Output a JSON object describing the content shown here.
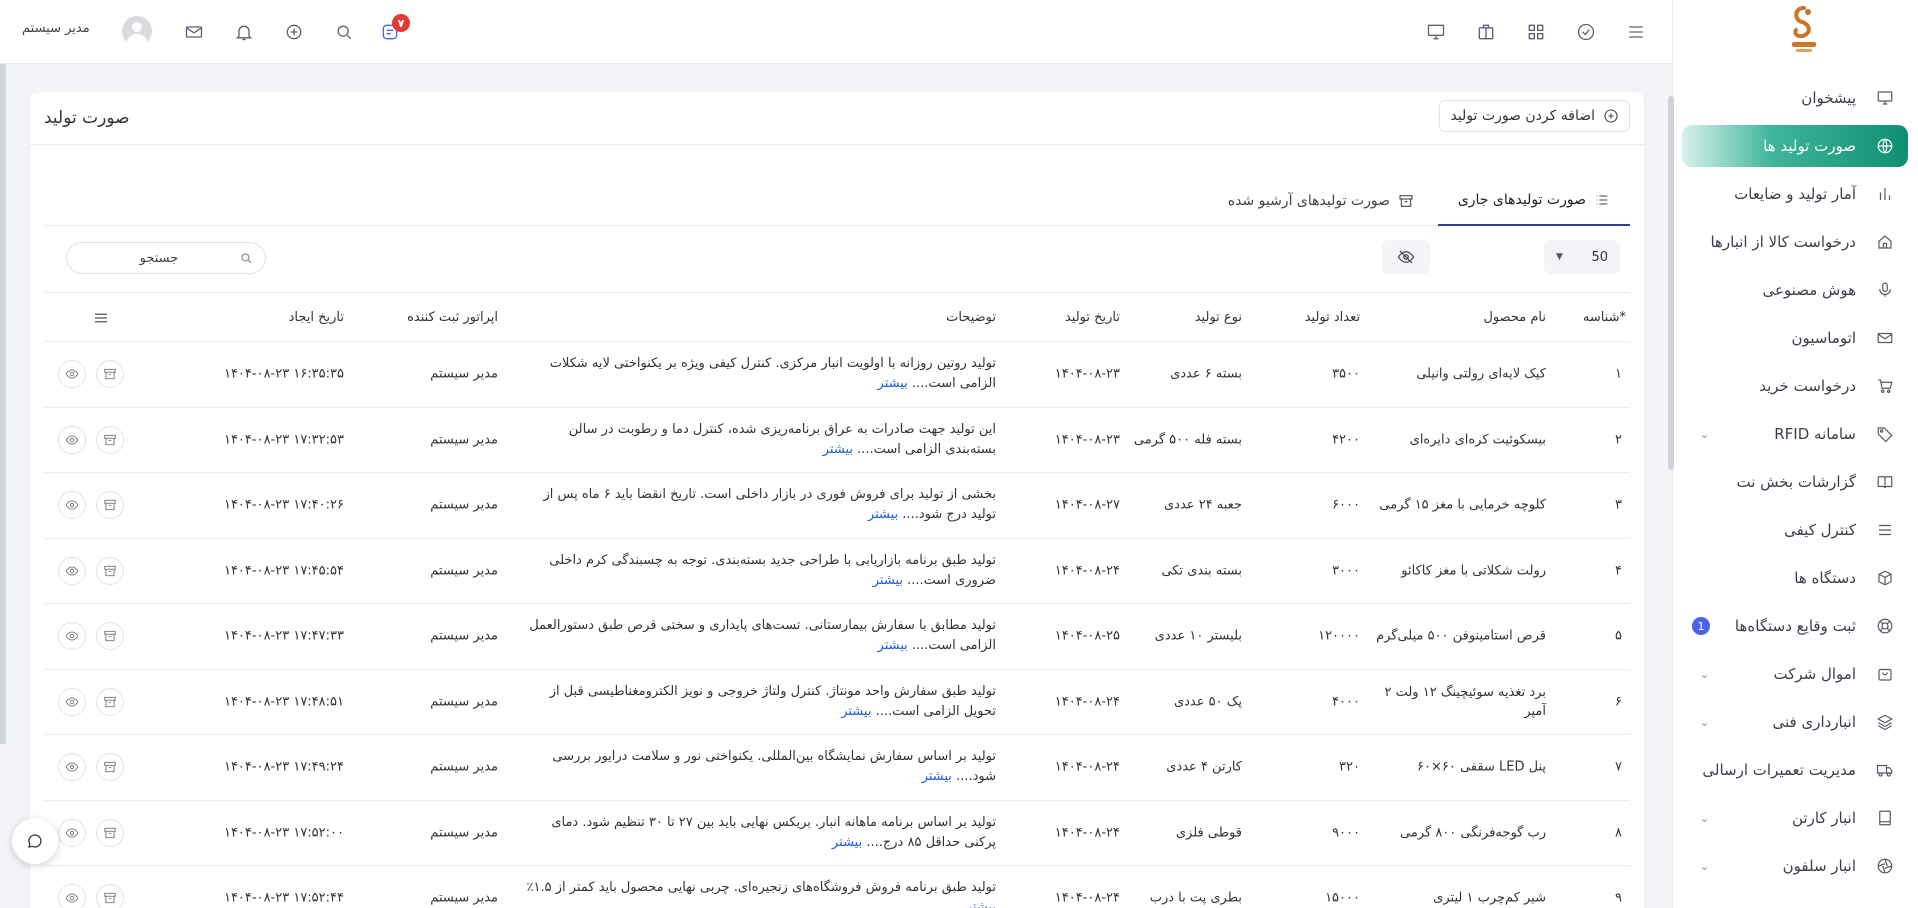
{
  "sidebar": {
    "items": [
      {
        "label": "پیشخوان",
        "icon": "monitor-icon",
        "active": false
      },
      {
        "label": "صورت تولید ها",
        "icon": "globe-icon",
        "active": true
      },
      {
        "label": "آمار تولید و ضایعات",
        "icon": "bar-chart-icon",
        "active": false
      },
      {
        "label": "درخواست کالا از انبارها",
        "icon": "home-icon",
        "active": false
      },
      {
        "label": "هوش مصنوعی",
        "icon": "microphone-icon",
        "active": false
      },
      {
        "label": "اتوماسیون",
        "icon": "mail-icon",
        "active": false
      },
      {
        "label": "درخواست خرید",
        "icon": "cart-icon",
        "active": false
      },
      {
        "label": "سامانه RFID",
        "icon": "tag-icon",
        "active": false,
        "chevron": true
      },
      {
        "label": "گزارشات بخش نت",
        "icon": "book-icon",
        "active": false
      },
      {
        "label": "کنترل کیفی",
        "icon": "list-icon",
        "active": false
      },
      {
        "label": "دستگاه ها",
        "icon": "cube-icon",
        "active": false
      },
      {
        "label": "ثبت وقایع دستگاه‌ها",
        "icon": "lifebuoy-icon",
        "active": false,
        "badge": "1"
      },
      {
        "label": "اموال شرکت",
        "icon": "bag-icon",
        "active": false,
        "chevron": true
      },
      {
        "label": "انبارداری فنی",
        "icon": "layers-icon",
        "active": false,
        "chevron": true
      },
      {
        "label": "مدیریت تعمیرات ارسالی",
        "icon": "truck-icon",
        "active": false
      },
      {
        "label": "انبار کارتن",
        "icon": "notebook-icon",
        "active": false,
        "chevron": true
      },
      {
        "label": "انبار سلفون",
        "icon": "aperture-icon",
        "active": false,
        "chevron": true
      }
    ]
  },
  "topbar": {
    "notification_count": "۷",
    "user_name": "مدیر سیستم"
  },
  "page": {
    "title": "صورت تولید",
    "add_button": "اضافه کردن صورت تولید",
    "tab_current": "صورت تولیدهای جاری",
    "tab_archived": "صورت تولیدهای آرشیو شده",
    "per_page": "50",
    "search_placeholder": "جستجو"
  },
  "table": {
    "headers": {
      "id": "شناسه",
      "name": "نام محصول",
      "qty": "تعداد تولید",
      "type": "نوع تولید",
      "date": "تاریخ تولید",
      "desc": "توضیحات",
      "operator": "اپراتور ثبت کننده",
      "created": "تاریخ ایجاد"
    },
    "more_label": "بیشتر",
    "rows": [
      {
        "id": "۱",
        "name": "کیک لایه‌ای رولتی وانیلی",
        "qty": "۳۵۰۰",
        "type": "بسته ۶ عددی",
        "date": "۱۴۰۴-۰۸-۲۳",
        "desc": "تولید روتین روزانه با اولویت انبار مرکزی. کنترل کیفی ویژه بر یکنواختی لایه شکلات الزامی است....",
        "operator": "مدیر سیستم",
        "created": "۱۴۰۴-۰۸-۲۳ ۱۶:۳۵:۳۵"
      },
      {
        "id": "۲",
        "name": "بیسکوئیت کره‌ای دایره‌ای",
        "qty": "۴۲۰۰",
        "type": "بسته فله ۵۰۰ گرمی",
        "date": "۱۴۰۴-۰۸-۲۳",
        "desc": "این تولید جهت صادرات به عراق برنامه‌ریزی شده، کنترل دما و رطوبت در سالن بسته‌بندی الزامی است....",
        "operator": "مدیر سیستم",
        "created": "۱۴۰۴-۰۸-۲۳ ۱۷:۳۲:۵۳"
      },
      {
        "id": "۳",
        "name": "کلوچه خرمایی با مغز ۱۵ گرمی",
        "qty": "۶۰۰۰",
        "type": "جعبه ۲۴ عددی",
        "date": "۱۴۰۴-۰۸-۲۷",
        "desc": "بخشی از تولید برای فروش فوری در بازار داخلی است. تاریخ انقضا باید ۶ ماه پس از تولید درج شود....",
        "operator": "مدیر سیستم",
        "created": "۱۴۰۴-۰۸-۲۳ ۱۷:۴۰:۲۶"
      },
      {
        "id": "۴",
        "name": "رولت شکلاتی با مغز کاکائو",
        "qty": "۳۰۰۰",
        "type": "بسته بندی تکی",
        "date": "۱۴۰۴-۰۸-۲۴",
        "desc": "تولید طبق برنامه بازاریابی با طراحی جدید بسته‌بندی. توجه به چسبندگی کرم داخلی ضروری است....",
        "operator": "مدیر سیستم",
        "created": "۱۴۰۴-۰۸-۲۳ ۱۷:۴۵:۵۴"
      },
      {
        "id": "۵",
        "name": "قرص استامینوفن ۵۰۰ میلی‌گرم",
        "qty": "۱۲۰۰۰۰",
        "type": "بلیستر ۱۰ عددی",
        "date": "۱۴۰۴-۰۸-۲۵",
        "desc": "تولید مطابق با سفارش بیمارستانی. تست‌های پایداری و سختی قرص طبق دستورالعمل الزامی است....",
        "operator": "مدیر سیستم",
        "created": "۱۴۰۴-۰۸-۲۳ ۱۷:۴۷:۳۳"
      },
      {
        "id": "۶",
        "name": "برد تغذیه سوئیچینگ ۱۲ ولت ۲ آمپر",
        "qty": "۴۰۰۰",
        "type": "پک ۵۰ عددی",
        "date": "۱۴۰۴-۰۸-۲۴",
        "desc": "تولید طبق سفارش واحد مونتاژ. کنترل ولتاژ خروجی و نویز الکترومغناطیسی قبل از تحویل الزامی است....",
        "operator": "مدیر سیستم",
        "created": "۱۴۰۴-۰۸-۲۳ ۱۷:۴۸:۵۱"
      },
      {
        "id": "۷",
        "name": "پنل LED سقفی ۶۰×۶۰",
        "qty": "۳۲۰",
        "type": "کارتن ۴ عددی",
        "date": "۱۴۰۴-۰۸-۲۴",
        "desc": "تولید بر اساس سفارش نمایشگاه بین‌المللی. یکنواختی نور و سلامت درایور بررسی شود....",
        "operator": "مدیر سیستم",
        "created": "۱۴۰۴-۰۸-۲۳ ۱۷:۴۹:۲۴"
      },
      {
        "id": "۸",
        "name": "رب گوجه‌فرنگی ۸۰۰ گرمی",
        "qty": "۹۰۰۰",
        "type": "قوطی فلزی",
        "date": "۱۴۰۴-۰۸-۲۴",
        "desc": "تولید بر اساس برنامه ماهانه انبار. بریکس نهایی باید بین ۲۷ تا ۳۰ تنظیم شود. دمای پرکنی حداقل ۸۵ درج....",
        "operator": "مدیر سیستم",
        "created": "۱۴۰۴-۰۸-۲۳ ۱۷:۵۲:۰۰"
      },
      {
        "id": "۹",
        "name": "شیر کم‌چرب ۱ لیتری",
        "qty": "۱۵۰۰۰",
        "type": "بطری پت با درب",
        "date": "۱۴۰۴-۰۸-۲۴",
        "desc": "تولید طبق برنامه فروش فروشگاه‌های زنجیره‌ای. چربی نهایی محصول باید کمتر از ۱.۵٪",
        "operator": "مدیر سیستم",
        "created": "۱۴۰۴-۰۸-۲۳ ۱۷:۵۲:۴۴"
      }
    ]
  }
}
